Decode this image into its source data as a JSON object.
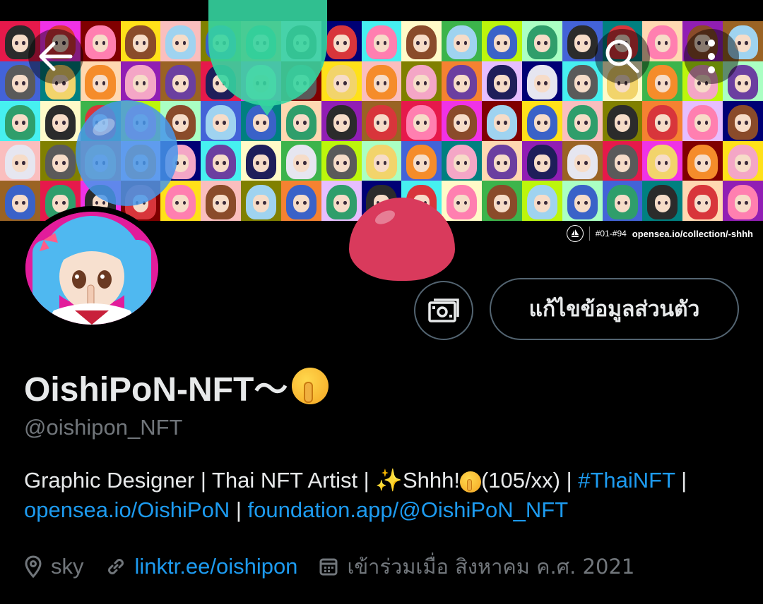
{
  "banner": {
    "collection_range": "#01-#94",
    "collection_link": "opensea.io/collection/-shhh",
    "tile_colors": [
      "#e6194b",
      "#3cb44b",
      "#ffe119",
      "#4363d8",
      "#f58231",
      "#911eb4",
      "#46f0f0",
      "#f032e6",
      "#bcf60c",
      "#fabebe",
      "#008080",
      "#e6beff",
      "#9a6324",
      "#fffac8",
      "#800000",
      "#aaffc3",
      "#808000",
      "#ffd8b1",
      "#000075"
    ],
    "hair_colors": [
      "#2b2b2b",
      "#f4a6c6",
      "#3a62c8",
      "#f2d46b",
      "#8a4b2a",
      "#e6e6f0",
      "#d8353b",
      "#6b3fa0",
      "#2f9e6b",
      "#f58c2a",
      "#9fd3f0",
      "#5a5a5a",
      "#ff7fb0",
      "#1e1e5a"
    ]
  },
  "header": {
    "back_icon": "arrow-left-icon",
    "search_icon": "search-icon",
    "more_icon": "more-vertical-icon"
  },
  "profile": {
    "display_name": "OishiPoN-NFT〜",
    "handle": "@oishipon_NFT",
    "edit_button_label": "แก้ไขข้อมูลส่วนตัว",
    "bio": {
      "part1": "Graphic Designer | Thai NFT Artist | ",
      "part2": "Shhh!",
      "part3": "(105/xx) | ",
      "hashtag": "#ThaiNFT",
      "part4": " |",
      "link1": "opensea.io/OishiPoN",
      "sep": " | ",
      "link2": "foundation.app/@OishiPoN_NFT"
    },
    "location": "sky",
    "website": "linktr.ee/oishipon",
    "joined": "เข้าร่วมเมื่อ สิงหาคม ค.ศ. 2021"
  },
  "colors": {
    "accent": "#1d9bf0",
    "muted": "#71767b",
    "text": "#e7e9ea",
    "border": "#536471"
  }
}
